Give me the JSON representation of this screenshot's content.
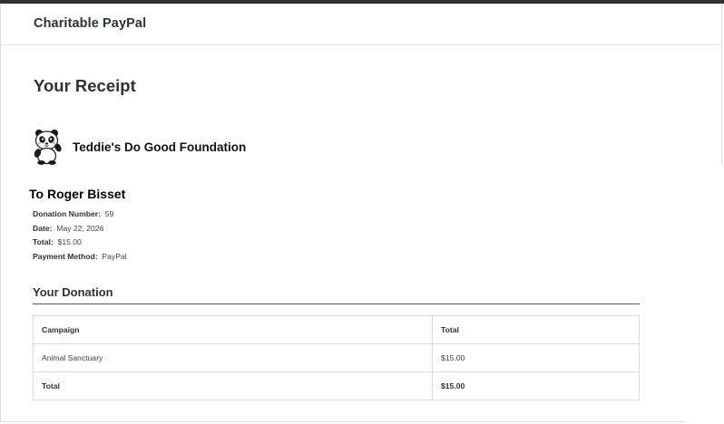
{
  "app": {
    "title": "Charitable PayPal"
  },
  "receipt": {
    "title": "Your Receipt"
  },
  "organization": {
    "name": "Teddie's Do Good Foundation",
    "logo_icon": "panda-mascot-icon"
  },
  "recipient": {
    "line": "To Roger Bisset"
  },
  "details": [
    {
      "label": "Donation Number:",
      "value": "59"
    },
    {
      "label": "Date:",
      "value": "May 22, 2026"
    },
    {
      "label": "Total:",
      "value": "$15.00"
    },
    {
      "label": "Payment Method:",
      "value": "PayPal"
    }
  ],
  "donation": {
    "title": "Your Donation",
    "headers": {
      "campaign": "Campaign",
      "total": "Total"
    },
    "rows": [
      {
        "campaign": "Animal Sanctuary",
        "total": "$15.00"
      }
    ],
    "footer": {
      "label": "Total",
      "total": "$15.00"
    }
  },
  "colors": {
    "topbar": "#2c3338",
    "text": "#2c3338",
    "border": "#dcdcde"
  }
}
